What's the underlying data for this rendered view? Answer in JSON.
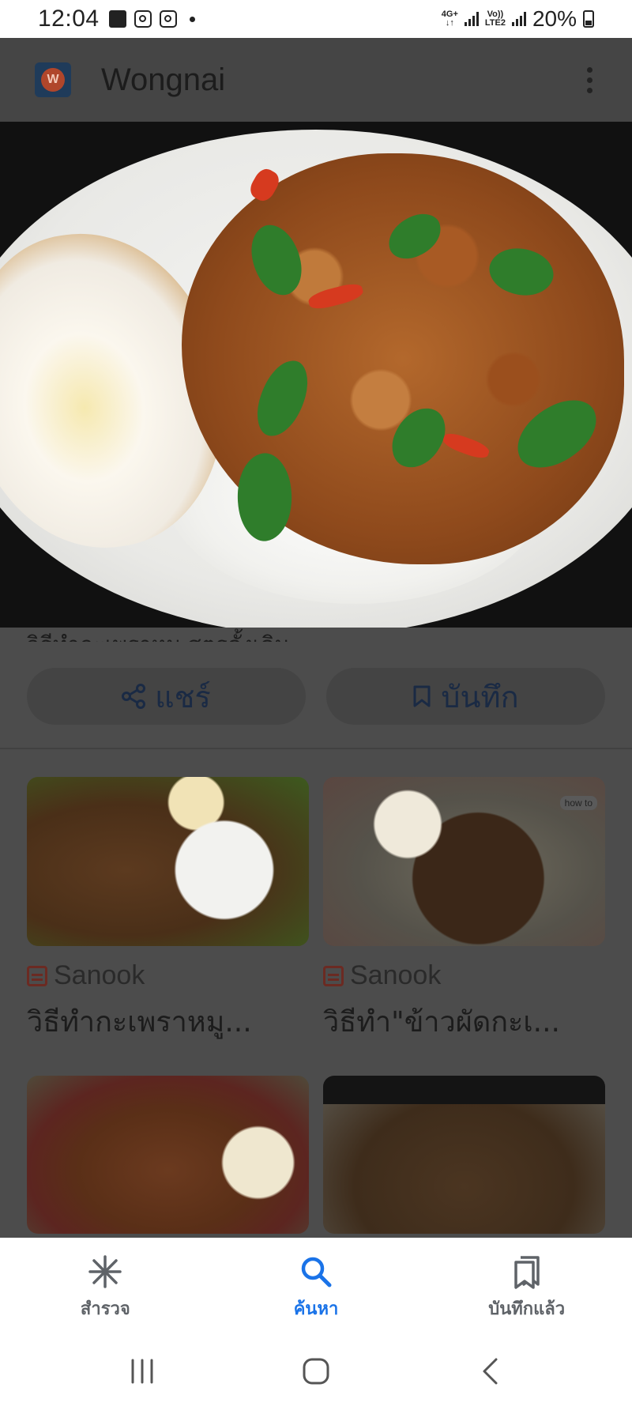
{
  "status_bar": {
    "time": "12:04",
    "network_top": "4G+",
    "network_bottom": "↓↑",
    "volte_top": "Vo))",
    "volte_bottom": "LTE2",
    "battery": "20%"
  },
  "app_header": {
    "logo_letter": "W",
    "title": "Wongnai"
  },
  "hero": {
    "subtitle_partial": "วิธีทำกะเพราหมู สูตรดั้งเดิม"
  },
  "actions": {
    "share_label": "แชร์",
    "save_label": "บันทึก"
  },
  "results": [
    {
      "source": "Sanook",
      "title": "วิธีทำกะเพราหมู..."
    },
    {
      "source": "Sanook",
      "title": "วิธีทำ\"ข้าวผัดกะเ...",
      "badge": "how to"
    }
  ],
  "bottom_nav": {
    "explore_label": "สำรวจ",
    "search_label": "ค้นหา",
    "saved_label": "บันทึกแล้ว"
  },
  "colors": {
    "accent": "#1a73e8",
    "overlay": "#4c4c4c",
    "source_icon": "#6b2a22"
  },
  "icons": [
    "gallery-icon",
    "instagram-icon",
    "share-icon",
    "bookmark-icon",
    "sparkle-icon",
    "search-icon",
    "saved-icon",
    "recent-apps-icon",
    "home-icon",
    "back-icon"
  ]
}
